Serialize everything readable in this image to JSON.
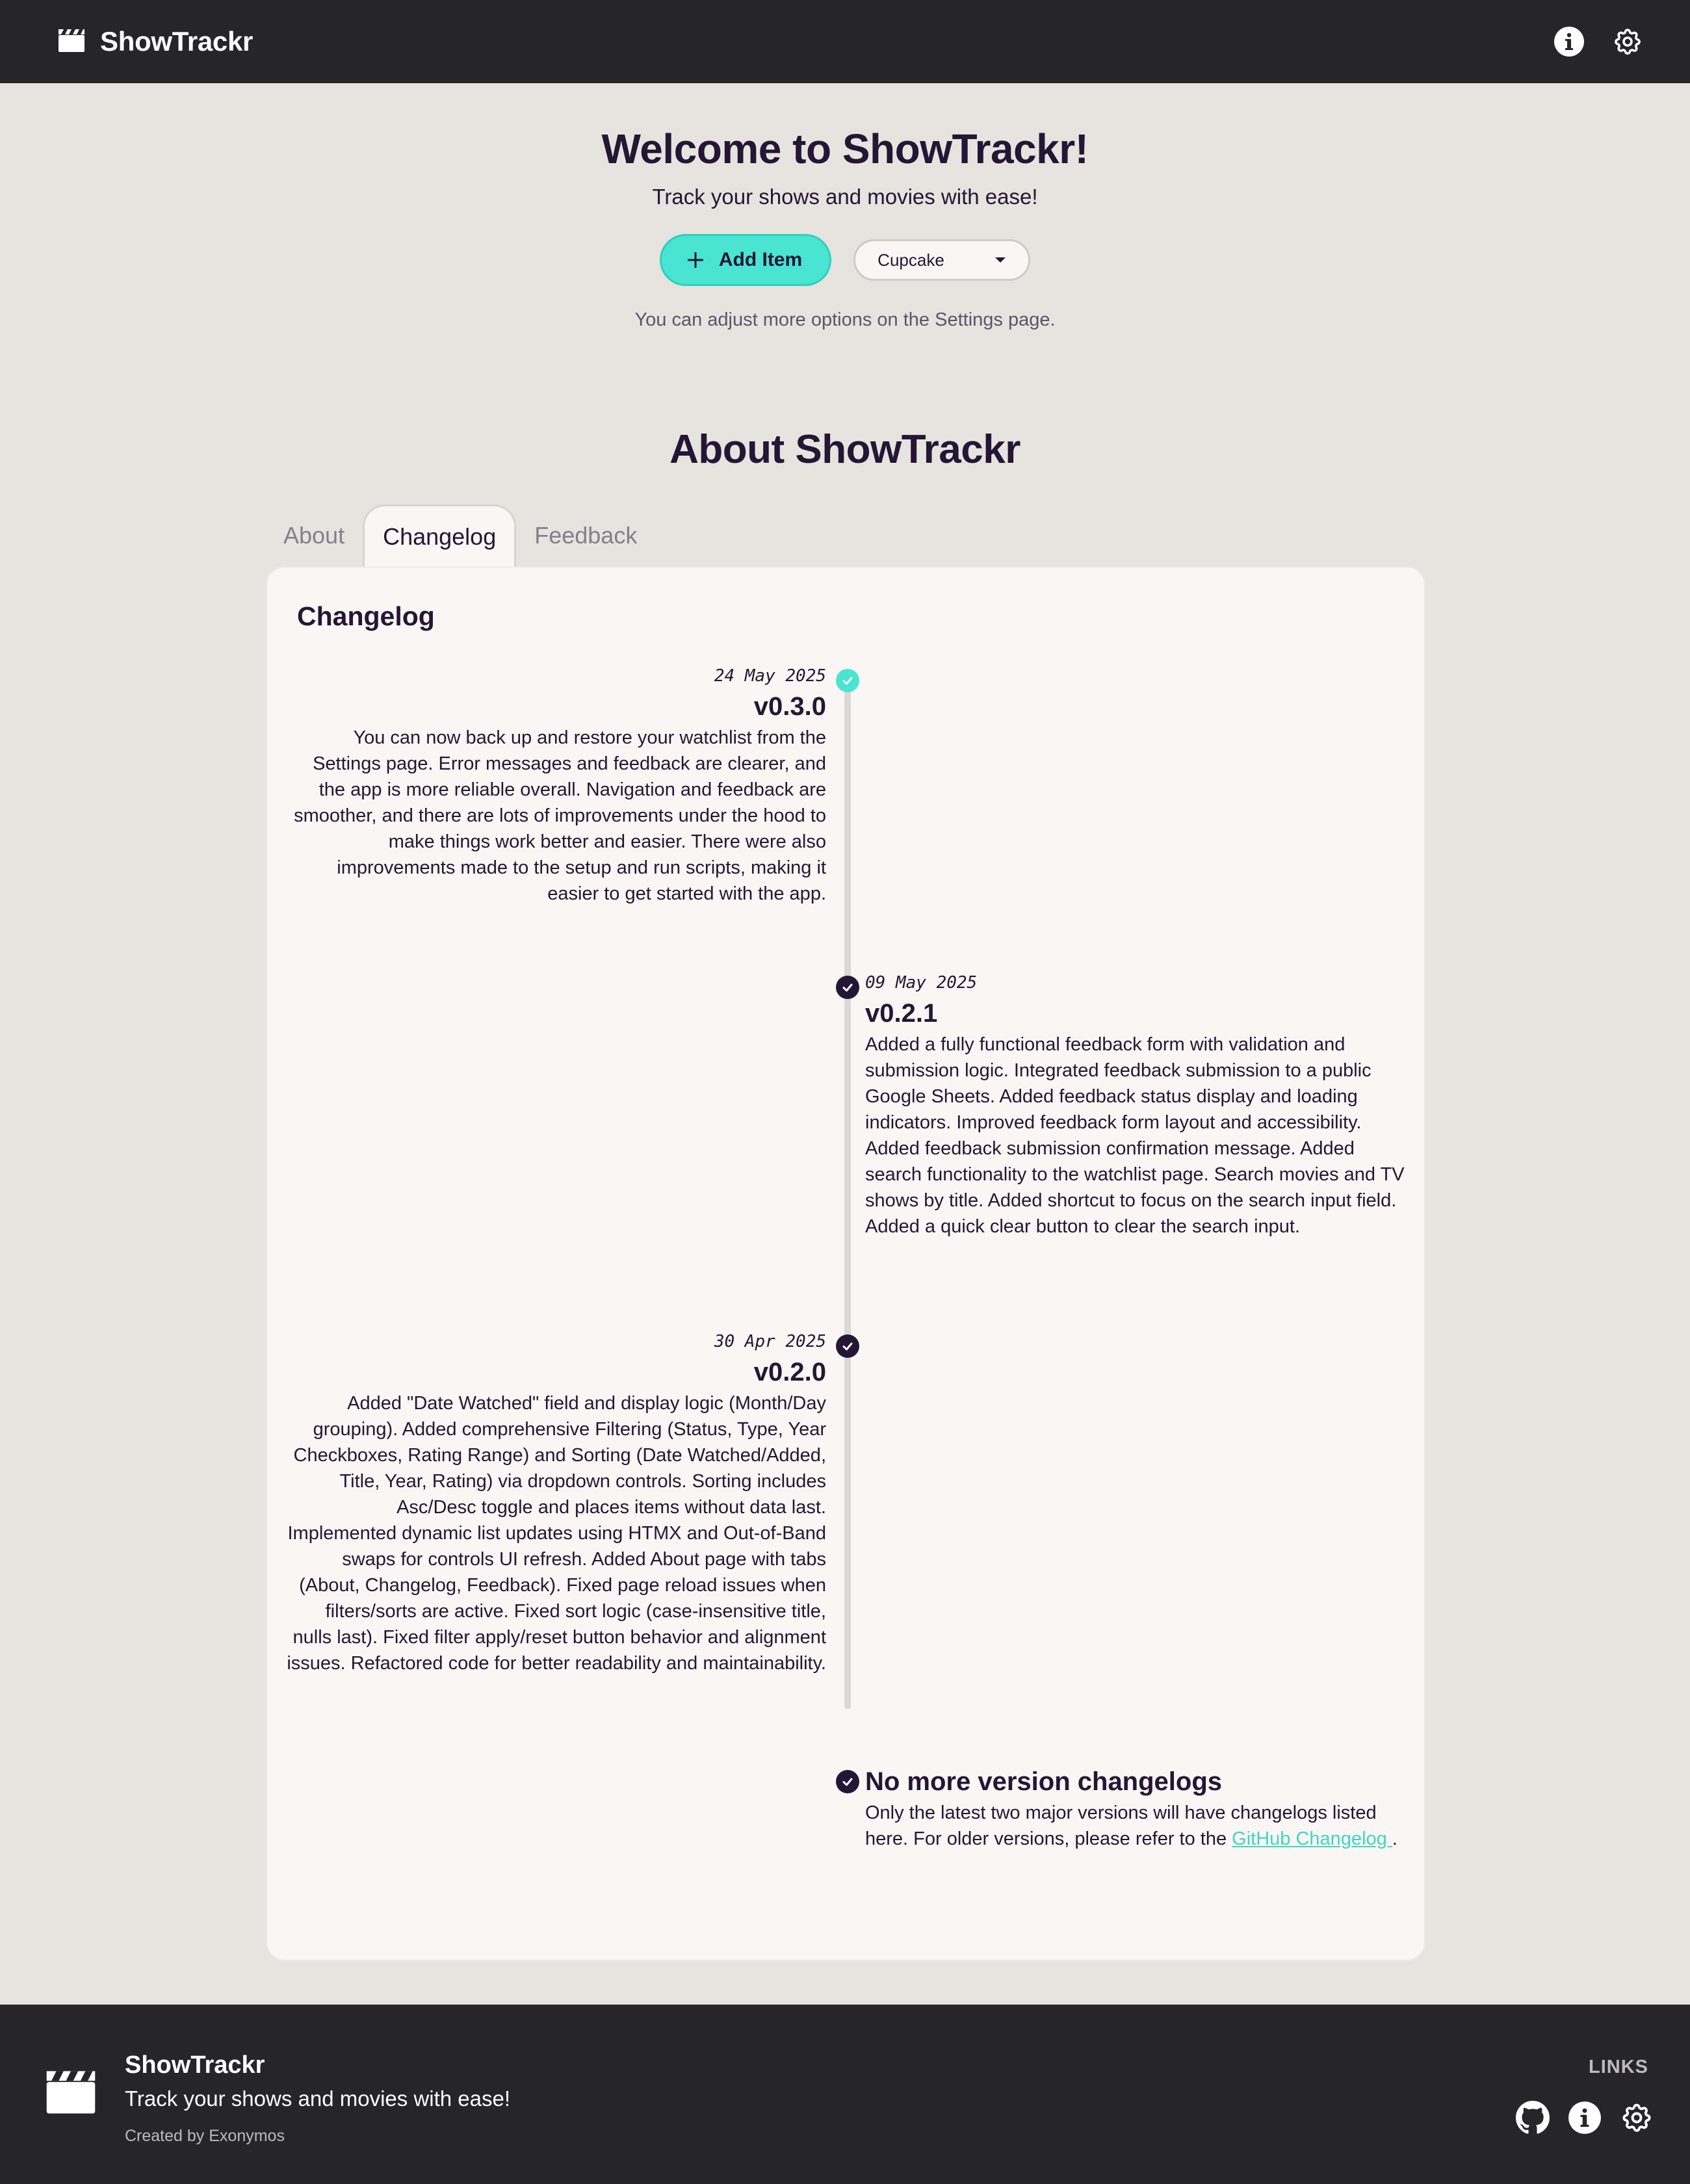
{
  "navbar": {
    "brand": "ShowTrackr",
    "logo_icon": "clapperboard-icon",
    "info_icon": "info-icon",
    "settings_icon": "gear-icon"
  },
  "hero": {
    "title": "Welcome to ShowTrackr!",
    "subtitle": "Track your shows and movies with ease!",
    "add_button_label": "Add Item",
    "theme_select_value": "Cupcake",
    "hint": "You can adjust more options on the Settings page."
  },
  "about": {
    "title": "About ShowTrackr",
    "tabs": [
      {
        "label": "About",
        "active": false
      },
      {
        "label": "Changelog",
        "active": true
      },
      {
        "label": "Feedback",
        "active": false
      }
    ],
    "card_title": "Changelog",
    "entries": [
      {
        "date": "24 May 2025",
        "version": "v0.3.0",
        "text": "You can now back up and restore your watchlist from the Settings page. Error messages and feedback are clearer, and the app is more reliable overall. Navigation and feedback are smoother, and there are lots of improvements under the hood to make things work better and easier. There were also improvements made to the setup and run scripts, making it easier to get started with the app."
      },
      {
        "date": "09 May 2025",
        "version": "v0.2.1",
        "text": "Added a fully functional feedback form with validation and submission logic. Integrated feedback submission to a public Google Sheets. Added feedback status display and loading indicators. Improved feedback form layout and accessibility. Added feedback submission confirmation message. Added search functionality to the watchlist page. Search movies and TV shows by title. Added shortcut to focus on the search input field. Added a quick clear button to clear the search input."
      },
      {
        "date": "30 Apr 2025",
        "version": "v0.2.0",
        "text": "Added \"Date Watched\" field and display logic (Month/Day grouping). Added comprehensive Filtering (Status, Type, Year Checkboxes, Rating Range) and Sorting (Date Watched/Added, Title, Year, Rating) via dropdown controls. Sorting includes Asc/Desc toggle and places items without data last. Implemented dynamic list updates using HTMX and Out-of-Band swaps for controls UI refresh. Added About page with tabs (About, Changelog, Feedback). Fixed page reload issues when filters/sorts are active. Fixed sort logic (case-insensitive title, nulls last). Fixed filter apply/reset button behavior and alignment issues. Refactored code for better readability and maintainability."
      }
    ],
    "final": {
      "title": "No more version changelogs",
      "text_before": "Only the latest two major versions will have changelogs listed here. For older versions, please refer to the ",
      "link_text": "GitHub Changelog ",
      "text_after": "."
    }
  },
  "footer": {
    "brand": "ShowTrackr",
    "tagline": "Track your shows and movies with ease!",
    "credit": "Created by Exonymos",
    "links_title": "LINKS",
    "icons": [
      "github-icon",
      "info-icon",
      "gear-icon"
    ]
  },
  "colors": {
    "accent": "#49e4d2",
    "dark": "#241634",
    "navbar": "#262628",
    "background": "#e7e3df",
    "card": "#f9f6f3"
  }
}
